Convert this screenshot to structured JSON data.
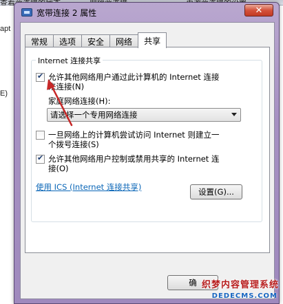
{
  "background": {
    "left_fragments": [
      "apt",
      "E)"
    ],
    "right_fragments": [
      "地:",
      "eal"
    ],
    "top_fragments": [
      "查看此连接的状态",
      "删除此连接",
      "更改此连接的设置"
    ]
  },
  "dialog": {
    "title": "宽带连接 2 属性",
    "close_symbol": "✕",
    "tabs": [
      {
        "label": "常规",
        "active": false
      },
      {
        "label": "选项",
        "active": false
      },
      {
        "label": "安全",
        "active": false
      },
      {
        "label": "网络",
        "active": false
      },
      {
        "label": "共享",
        "active": true
      }
    ],
    "group_title": "Internet 连接共享",
    "option1": {
      "checked": true,
      "line1": "允许其他网络用户通过此计算机的 Internet 连接",
      "line2": "来连接(N)"
    },
    "home_network_label": "家庭网络连接(H):",
    "home_network_select": "请选择一个专用网络连接",
    "option2": {
      "checked": false,
      "line1": "一旦网络上的计算机尝试访问 Internet 则建立一",
      "line2": "个拨号连接(S)"
    },
    "option3": {
      "checked": true,
      "line1": "允许其他网络用户控制或禁用共享的 Internet 连",
      "line2": "接(O)"
    },
    "ics_link": "使用 ICS (Internet 连接共享)",
    "settings_button": "设置(G)...",
    "ok_button_partial": "确"
  },
  "annotation": {
    "arrow_color": "#c62828"
  },
  "watermark": {
    "line1": "织梦内容管理系统",
    "line2": "DEDECMS.COM"
  }
}
